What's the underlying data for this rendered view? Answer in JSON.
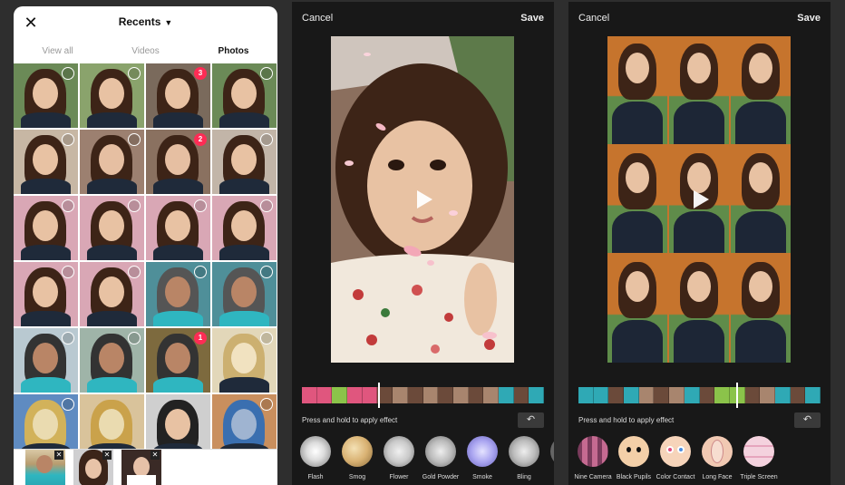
{
  "picker": {
    "title": "Recents",
    "tabs": [
      {
        "label": "View all",
        "active": false
      },
      {
        "label": "Videos",
        "active": false
      },
      {
        "label": "Photos",
        "active": true
      }
    ],
    "selection_badges": [
      "3",
      "2",
      "1"
    ]
  },
  "editor_left": {
    "cancel_label": "Cancel",
    "save_label": "Save",
    "hint": "Press and hold to apply effect",
    "effects": [
      {
        "label": "Flash",
        "icon": "flash-effect-icon"
      },
      {
        "label": "Smog",
        "icon": "smog-effect-icon"
      },
      {
        "label": "Flower",
        "icon": "flower-effect-icon"
      },
      {
        "label": "Gold Powder",
        "icon": "gold-powder-effect-icon"
      },
      {
        "label": "Smoke",
        "icon": "smoke-effect-icon"
      },
      {
        "label": "Bling",
        "icon": "bling-effect-icon"
      }
    ]
  },
  "editor_right": {
    "cancel_label": "Cancel",
    "save_label": "Save",
    "hint": "Press and hold to apply effect",
    "effects": [
      {
        "label": "Nine Camera",
        "icon": "nine-camera-effect-icon"
      },
      {
        "label": "Black Pupils",
        "icon": "black-pupils-effect-icon"
      },
      {
        "label": "Color Contact",
        "icon": "color-contact-effect-icon"
      },
      {
        "label": "Long Face",
        "icon": "long-face-effect-icon"
      },
      {
        "label": "Triple Screen",
        "icon": "triple-screen-effect-icon"
      }
    ]
  },
  "colors": {
    "accent": "#fe2c55",
    "editor_bg": "#181818",
    "effect_marker_pink": "#e0567e",
    "effect_marker_green": "#8bc34a"
  }
}
